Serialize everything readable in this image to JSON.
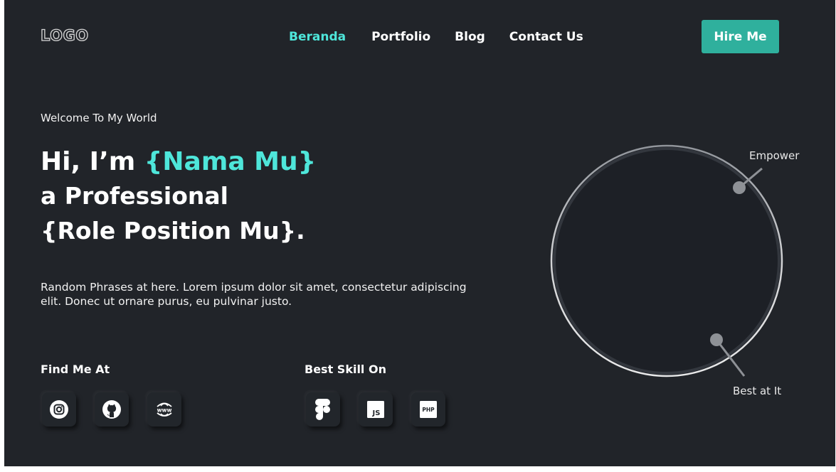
{
  "header": {
    "logo": "LOGO",
    "nav": [
      "Beranda",
      "Portfolio",
      "Blog",
      "Contact Us"
    ],
    "active_nav": "Beranda",
    "hire_label": "Hire Me"
  },
  "hero": {
    "welcome": "Welcome To My World",
    "greeting": "Hi, I’m ",
    "name": "{Nama Mu}",
    "line2": "a Professional",
    "line3": "{Role Position Mu}.",
    "phrase": "Random Phrases at here. Lorem ipsum dolor sit amet, consectetur adipiscing elit. Donec ut ornare purus, eu pulvinar justo."
  },
  "find_me": {
    "title": "Find Me At",
    "icons": [
      "instagram-icon",
      "github-icon",
      "www-icon"
    ]
  },
  "skills": {
    "title": "Best Skill On",
    "icons": [
      "figma-icon",
      "javascript-icon",
      "php-icon"
    ],
    "js_label": "JS",
    "php_label": "PHP"
  },
  "decoration": {
    "label_top": "Empower",
    "label_bottom": "Best at It"
  },
  "colors": {
    "background": "#212429",
    "accent": "#4ee6da",
    "button": "#2fb09d"
  }
}
